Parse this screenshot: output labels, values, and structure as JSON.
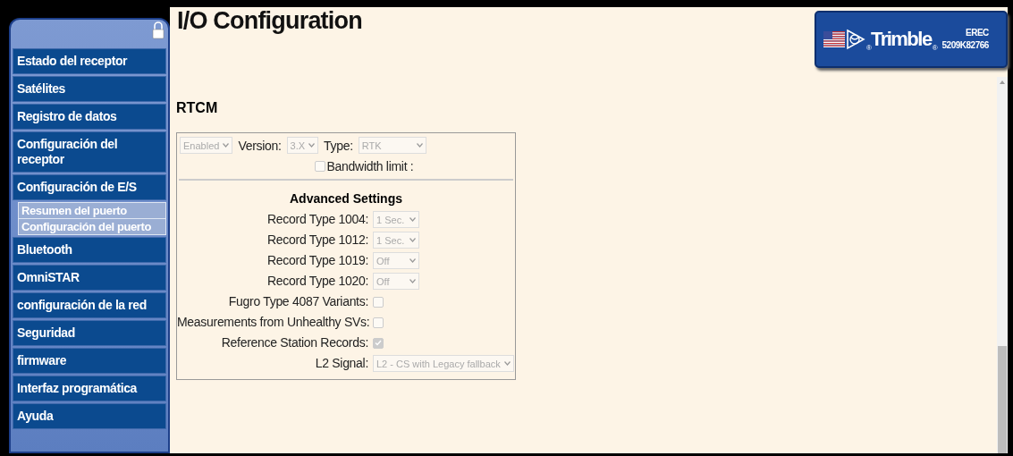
{
  "sidebar": {
    "items": [
      {
        "label": "Estado del receptor"
      },
      {
        "label": "Satélites"
      },
      {
        "label": "Registro de datos"
      },
      {
        "label": "Configuración del receptor"
      },
      {
        "label": "Configuración de E/S",
        "children": [
          {
            "label": "Resumen del puerto"
          },
          {
            "label": "Configuración del puerto"
          }
        ]
      },
      {
        "label": "Bluetooth"
      },
      {
        "label": "OmniSTAR"
      },
      {
        "label": "configuración de la red"
      },
      {
        "label": "Seguridad"
      },
      {
        "label": "firmware"
      },
      {
        "label": "Interfaz programática"
      },
      {
        "label": "Ayuda"
      }
    ]
  },
  "page": {
    "title": "I/O Configuration",
    "section": "RTCM"
  },
  "logo": {
    "brand": "Trimble",
    "marks": [
      "®",
      "®"
    ],
    "model": "EREC",
    "serial": "5209K82766"
  },
  "form": {
    "top": [
      {
        "kind": "select",
        "value": "Enabled",
        "disabled": true
      },
      {
        "kind": "label",
        "text": "Version:"
      },
      {
        "kind": "select",
        "value": "3.X",
        "disabled": true
      },
      {
        "kind": "label",
        "text": "Type:"
      },
      {
        "kind": "select",
        "value": "RTK",
        "disabled": true
      }
    ],
    "bandwidth": {
      "label": "Bandwidth limit :",
      "checked": false,
      "disabled": true
    },
    "advanced_title": "Advanced Settings",
    "rows": [
      {
        "kind": "select",
        "label": "Record Type 1004:",
        "value": "1 Sec.",
        "disabled": true
      },
      {
        "kind": "select",
        "label": "Record Type 1012:",
        "value": "1 Sec.",
        "disabled": true
      },
      {
        "kind": "select",
        "label": "Record Type 1019:",
        "value": "Off",
        "disabled": true
      },
      {
        "kind": "select",
        "label": "Record Type 1020:",
        "value": "Off",
        "disabled": true
      },
      {
        "kind": "checkbox",
        "label": "Fugro Type 4087 Variants:",
        "checked": false,
        "disabled": true
      },
      {
        "kind": "checkbox",
        "label": "Measurements from Unhealthy SVs:",
        "checked": false,
        "disabled": true
      },
      {
        "kind": "checkbox",
        "label": "Reference Station Records:",
        "checked": true,
        "disabled": true
      },
      {
        "kind": "wideselect",
        "label": "L2 Signal:",
        "value": "L2 - CS with Legacy fallback",
        "disabled": true
      }
    ]
  }
}
